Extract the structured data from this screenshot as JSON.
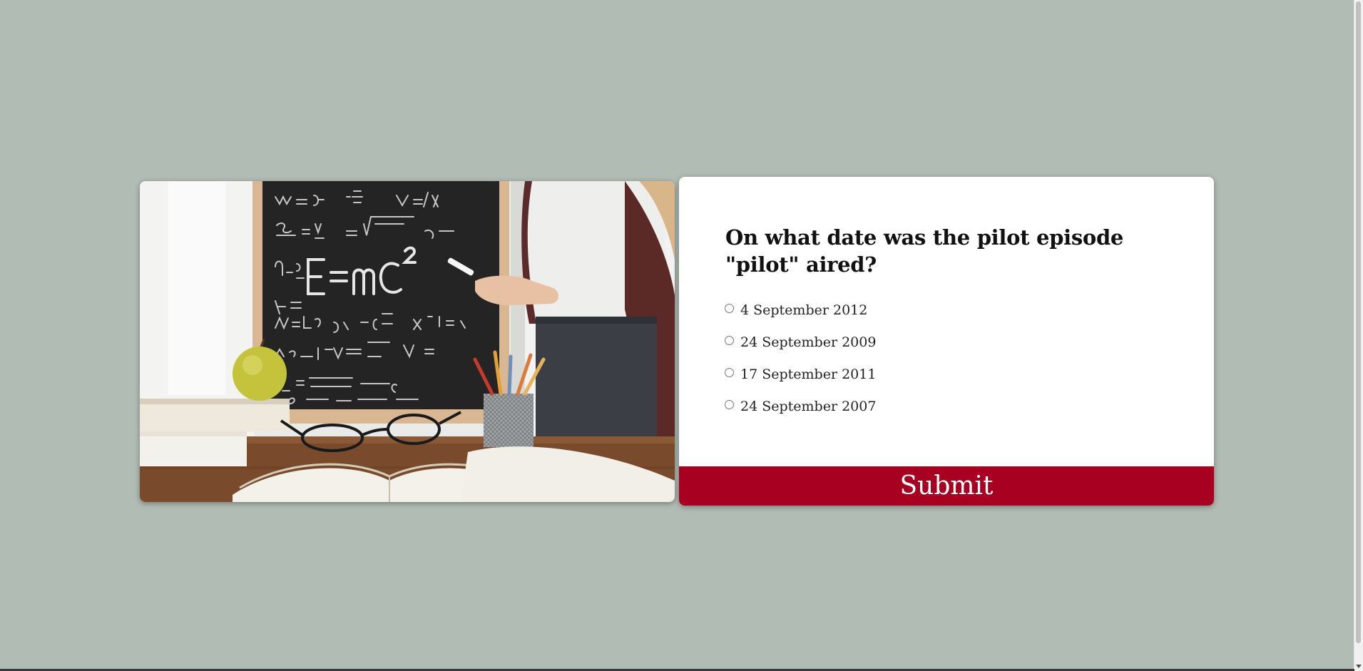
{
  "quiz": {
    "question": "On what date was the pilot episode \"pilot\" aired?",
    "options": [
      {
        "label": "4 September 2012",
        "selected": false
      },
      {
        "label": "24 September 2009",
        "selected": false
      },
      {
        "label": "17 September 2011",
        "selected": false
      },
      {
        "label": "24 September 2007",
        "selected": false
      }
    ],
    "submit_label": "Submit"
  },
  "image": {
    "description_icon": "classroom-photo",
    "chalkboard": {
      "lines": [
        "ω=2πf",
        "E=mc²",
        "Fu={Fn/R",
        "Fg=m₁m₂/r²",
        "cos(v₁ v₂) sin(v₁+v₂)"
      ]
    }
  },
  "colors": {
    "background": "#b1bcb4",
    "card": "#ffffff",
    "submit": "#a80020",
    "submit_text": "#ffffff",
    "chalkboard": "#1d1f1e"
  }
}
